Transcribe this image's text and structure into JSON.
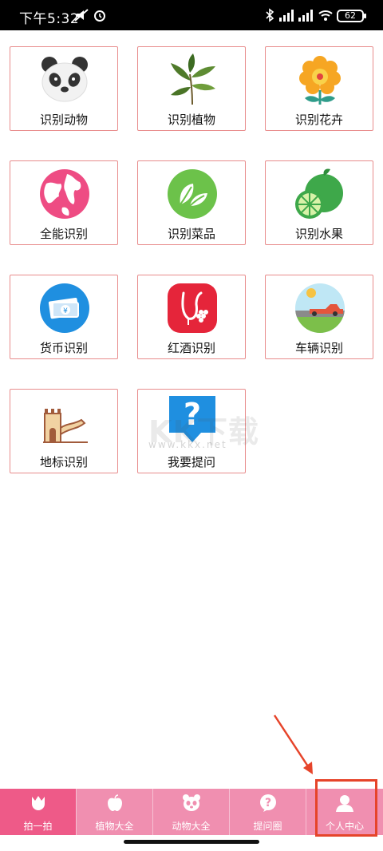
{
  "status_bar": {
    "time": "下午5:32",
    "battery": "62"
  },
  "grid": {
    "items": [
      {
        "label": "识别动物",
        "icon": "panda-icon"
      },
      {
        "label": "识别植物",
        "icon": "plant-icon"
      },
      {
        "label": "识别花卉",
        "icon": "flower-icon"
      },
      {
        "label": "全能识别",
        "icon": "globe-icon"
      },
      {
        "label": "识别菜品",
        "icon": "vegetable-leaf-icon"
      },
      {
        "label": "识别水果",
        "icon": "orange-fruit-icon"
      },
      {
        "label": "货币识别",
        "icon": "banknote-icon"
      },
      {
        "label": "红酒识别",
        "icon": "wine-icon"
      },
      {
        "label": "车辆识别",
        "icon": "car-icon"
      },
      {
        "label": "地标识别",
        "icon": "great-wall-icon"
      },
      {
        "label": "我要提问",
        "icon": "question-bubble-icon"
      }
    ]
  },
  "watermark": {
    "text": "KK下载",
    "url": "www.kkx.net"
  },
  "tabbar": {
    "tabs": [
      {
        "label": "拍一拍",
        "icon": "tulip-icon",
        "active": true
      },
      {
        "label": "植物大全",
        "icon": "apple-icon",
        "active": false
      },
      {
        "label": "动物大全",
        "icon": "panda-face-icon",
        "active": false
      },
      {
        "label": "提问圈",
        "icon": "question-icon",
        "active": false
      },
      {
        "label": "个人中心",
        "icon": "user-icon",
        "active": false
      }
    ]
  },
  "colors": {
    "tabbar": "#f08fb0",
    "tab_active": "#ee5a88",
    "card_border": "#e88c8c",
    "highlight": "#e6442a"
  }
}
